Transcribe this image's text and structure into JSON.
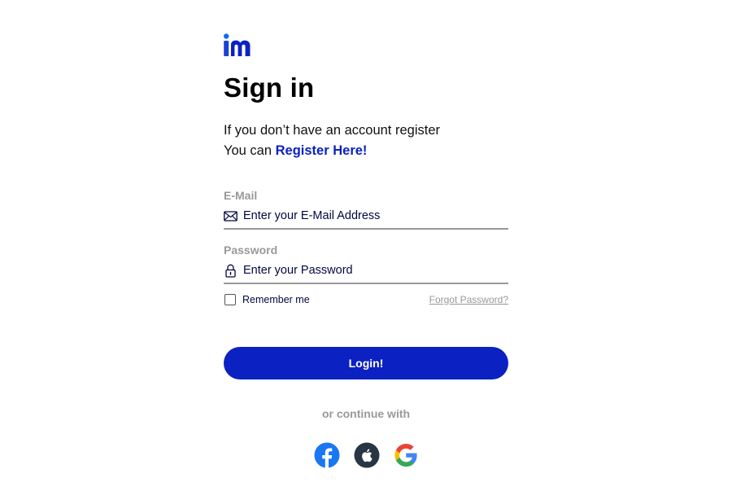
{
  "brand": {
    "logo_text": "im",
    "colors": {
      "i_dot": "#0c6cf2",
      "m": "#0c21c1",
      "i": "#1b3fd6"
    }
  },
  "header": {
    "title": "Sign in"
  },
  "intro": {
    "line1": "If you don’t have an account register",
    "line2_prefix": "You can ",
    "register_link": "Register Here!"
  },
  "form": {
    "email": {
      "label": "E-Mail",
      "placeholder": "Enter your E-Mail Address",
      "value": "",
      "icon": "envelope-icon"
    },
    "password": {
      "label": "Password",
      "placeholder": "Enter your Password",
      "value": "",
      "icon": "lock-icon"
    },
    "remember": {
      "label": "Remember me",
      "checked": false
    },
    "forgot_link": "Forgot Password?",
    "submit_label": "Login!"
  },
  "social": {
    "divider_text": "or continue with",
    "providers": [
      {
        "name": "facebook",
        "icon": "facebook-icon",
        "color": "#1877f2"
      },
      {
        "name": "apple",
        "icon": "apple-icon",
        "color": "#283544"
      },
      {
        "name": "google",
        "icon": "google-icon",
        "color": "#4285f4"
      }
    ]
  },
  "colors": {
    "accent": "#0c21c1",
    "text_dark": "#000842",
    "muted": "#999999"
  }
}
